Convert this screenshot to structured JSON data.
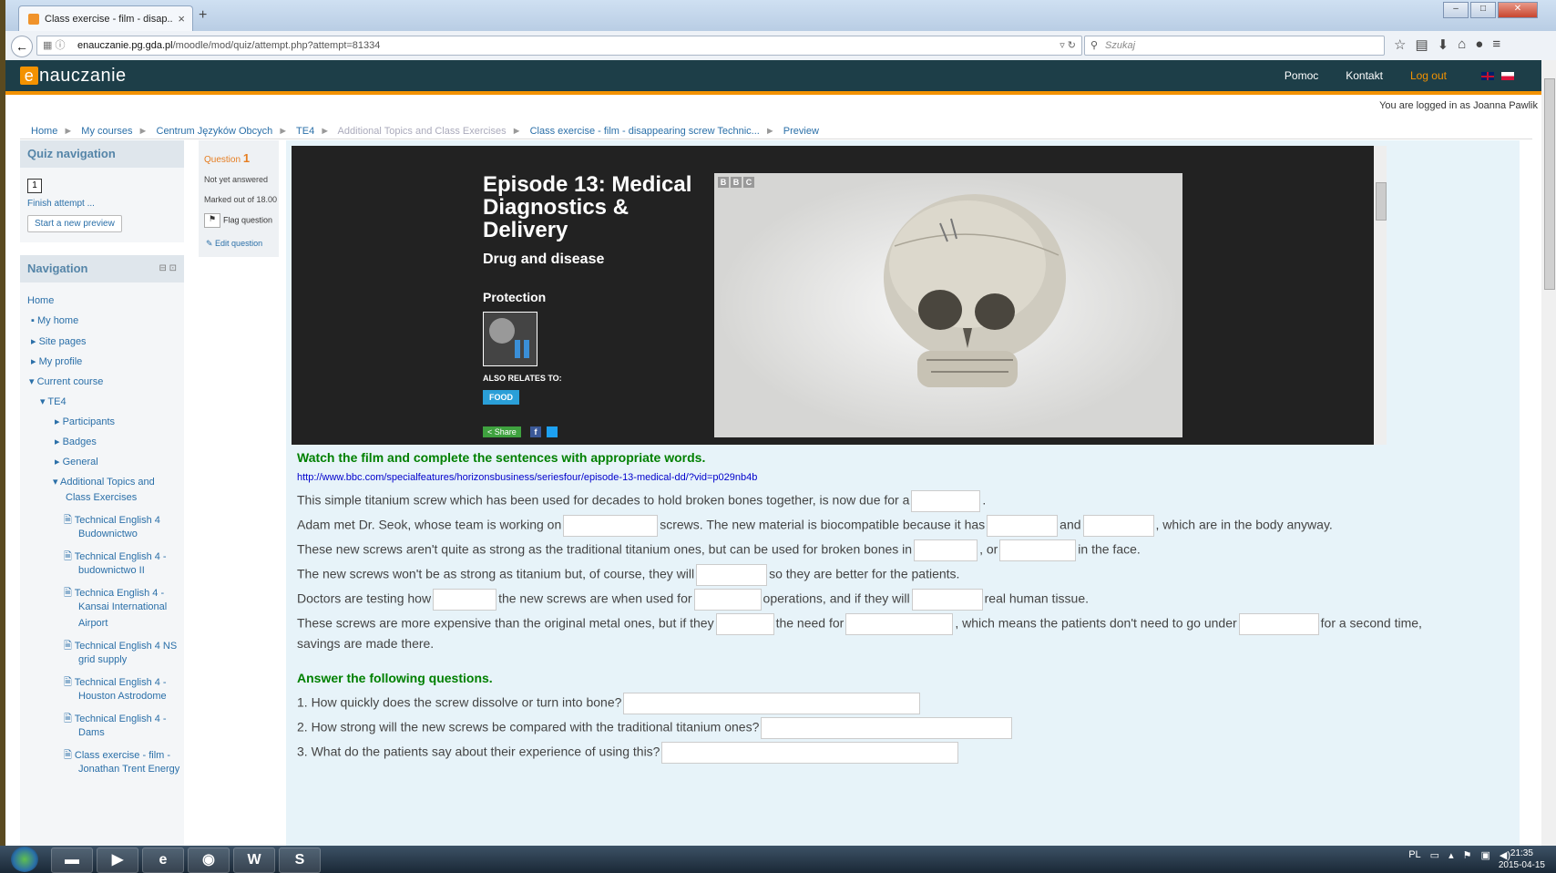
{
  "browser": {
    "tab_title": "Class exercise - film - disap...",
    "tab_close": "×",
    "new_tab": "+",
    "url_host": "enauczanie.pg.gda.pl",
    "url_path": "/moodle/mod/quiz/attempt.php?attempt=81334",
    "search_placeholder": "Szukaj"
  },
  "site": {
    "logo_e": "e",
    "logo_rest": "nauczanie",
    "nav": {
      "help": "Pomoc",
      "contact": "Kontakt",
      "logout": "Log out"
    },
    "logged_in": "You are logged in as Joanna Pawlik"
  },
  "breadcrumb": [
    "Home",
    "My courses",
    "Centrum Języków Obcych",
    "TE4",
    "Additional Topics and Class Exercises",
    "Class exercise - film - disappearing screw Technic...",
    "Preview"
  ],
  "quiz_nav": {
    "title": "Quiz navigation",
    "question_number": "1",
    "finish": "Finish attempt ...",
    "new_preview": "Start a new preview"
  },
  "navigation": {
    "title": "Navigation",
    "items": [
      "Home",
      "My home",
      "Site pages",
      "My profile",
      "Current course",
      "TE4",
      "Participants",
      "Badges",
      "General",
      "Additional Topics and",
      "Class Exercises",
      "Technical English 4",
      "Budownictwo",
      "Technical English 4 -",
      "budownictwo II",
      "Technica English 4 -",
      "Kansai International",
      "Airport",
      "Technical English 4 NS",
      "grid supply",
      "Technical English 4 -",
      "Houston Astrodome",
      "Technical English 4 -",
      "Dams",
      "Class exercise - film -",
      "Jonathan Trent Energy"
    ]
  },
  "question_info": {
    "label": "Question",
    "number": "1",
    "status": "Not yet answered",
    "marks": "Marked out of 18.00",
    "flag": "Flag question",
    "edit": "Edit question"
  },
  "video": {
    "episode": "Episode 13: Medical Diagnostics & Delivery",
    "subtitle": "Drug and disease",
    "section": "Protection",
    "also": "ALSO RELATES TO:",
    "tag": "FOOD",
    "share": "Share",
    "bbc": [
      "B",
      "B",
      "C"
    ]
  },
  "exercise": {
    "intro": "Watch the film and complete the sentences with appropriate words.",
    "link": "http://www.bbc.com/specialfeatures/horizonsbusiness/seriesfour/episode-13-medical-dd/?vid=p029nb4b",
    "s1a": "This simple titanium screw which has been used for decades to hold broken bones together, is now due for a",
    "s1b": ".",
    "s2a": "Adam met Dr. Seok, whose team is working on",
    "s2b": "screws. The new material is biocompatible because it has",
    "s2c": "and",
    "s2d": ", which are in the body anyway.",
    "s3a": "These new screws aren't quite as strong as the traditional titanium ones, but can be used for broken bones in",
    "s3b": ", or",
    "s3c": "in the face.",
    "s4a": "The new screws won't be as strong as titanium but, of course, they will",
    "s4b": "so they are better for the patients.",
    "s5a": "Doctors are testing how",
    "s5b": "the new screws are when used for",
    "s5c": "operations, and if they will",
    "s5d": "real human tissue.",
    "s6a": "These screws are more expensive than the original metal ones, but if they",
    "s6b": "the need for",
    "s6c": ", which means the patients don't need to go under",
    "s6d": "for a second time,",
    "s6e": "savings are made there.",
    "questions_title": "Answer the following questions.",
    "q1": "1. How quickly does the screw dissolve or turn into bone?",
    "q2": "2. How strong will the new screws be compared with the traditional titanium ones?",
    "q3": "3. What do the patients say about their experience of using this?"
  },
  "taskbar": {
    "lang": "PL",
    "time": "21:35",
    "date": "2015-04-15"
  }
}
